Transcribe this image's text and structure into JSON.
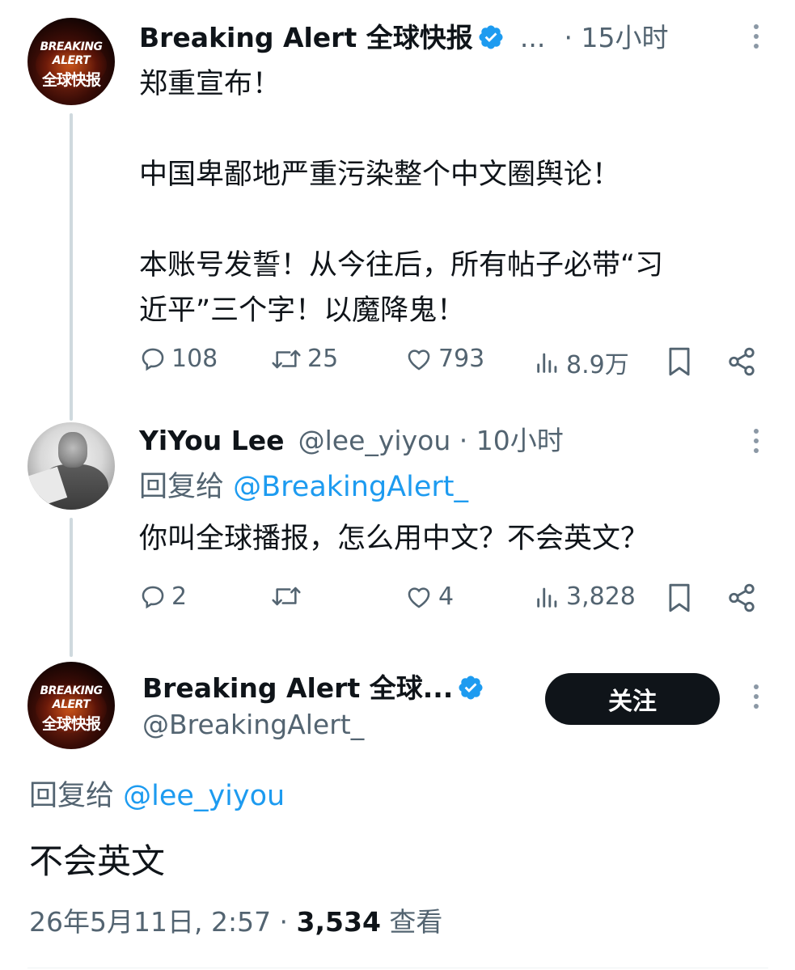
{
  "tweet1": {
    "display_name": "Breaking Alert 全球快报",
    "ellipsis": "...",
    "time": "· 15小时",
    "avatar_lines": [
      "BREAKING",
      "ALERT",
      "全球快报"
    ],
    "lines": [
      "郑重宣布！",
      "中国卑鄙地严重污染整个中文圈舆论！",
      "本账号发誓！从今往后，所有帖子必带“习",
      "近平”三个字！以魔降鬼！"
    ],
    "actions": {
      "replies": "108",
      "reposts": "25",
      "likes": "793",
      "views": "8.9万"
    }
  },
  "tweet2": {
    "display_name": "YiYou Lee",
    "handle_time": "@lee_yiyou · 10小时",
    "reply_prefix": "回复给",
    "reply_to": "@BreakingAlert_",
    "text": "你叫全球播报，怎么用中文？不会英文？",
    "actions": {
      "replies": "2",
      "reposts": "",
      "likes": "4",
      "views": "3,828"
    }
  },
  "main": {
    "display_name": "Breaking Alert 全球...",
    "handle": "@BreakingAlert_",
    "follow_label": "关注",
    "reply_prefix": "回复给",
    "reply_to": "@lee_yiyou",
    "text": "不会英文",
    "timestamp": "26年5月11日, 2:57 · ",
    "views_count": "3,534",
    "views_label": " 查看"
  },
  "colors": {
    "accent": "#1d9bf0",
    "text": "#0f1419",
    "muted": "#536471",
    "line": "#cfd9de"
  }
}
